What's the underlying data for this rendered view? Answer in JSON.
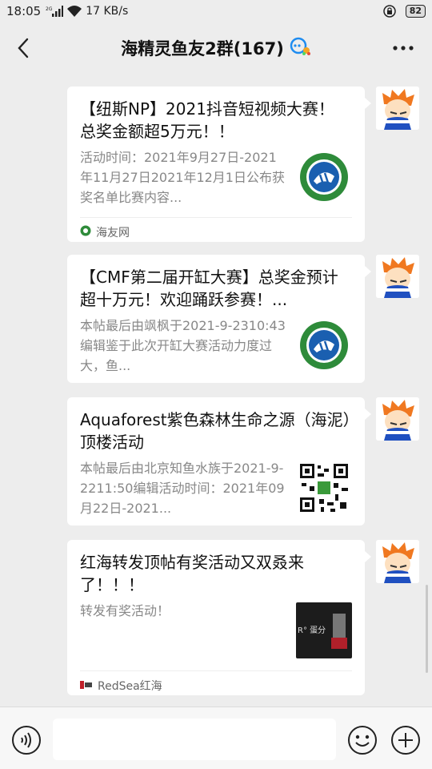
{
  "status": {
    "time": "18:05",
    "speed": "17 KB/s",
    "battery": "82",
    "signal_label": "2G"
  },
  "header": {
    "title": "海精灵鱼友2群(167)"
  },
  "messages": [
    {
      "title": "【纽斯NP】2021抖音短视频大赛！ 总奖金额超5万元！！",
      "desc": "活动时间：2021年9月27日-2021年11月27日2021年12月1日公布获奖名单比赛内容...",
      "source": "海友网",
      "thumb": "logo-green-fish-icon"
    },
    {
      "title": "【CMF第二届开缸大赛】总奖金预计超十万元！欢迎踊跃参赛！...",
      "desc": "本帖最后由飒枫于2021-9-2310:43编辑鉴于此次开缸大赛活动力度过大，鱼...",
      "source": "",
      "thumb": "logo-green-fish-icon"
    },
    {
      "title": "Aquaforest紫色森林生命之源（海泥）顶楼活动",
      "desc": "本帖最后由北京知鱼水族于2021-9-2211:50编辑活动时间：2021年09月22日-2021...",
      "source": "",
      "thumb": "qr-code-icon"
    },
    {
      "title": "红海转发顶帖有奖活动又双叒来了！！！",
      "desc": "转发有奖活动！",
      "source": "RedSea红海",
      "thumb": "redsea-product-image",
      "thumb_text": "R° 蛋分"
    }
  ]
}
